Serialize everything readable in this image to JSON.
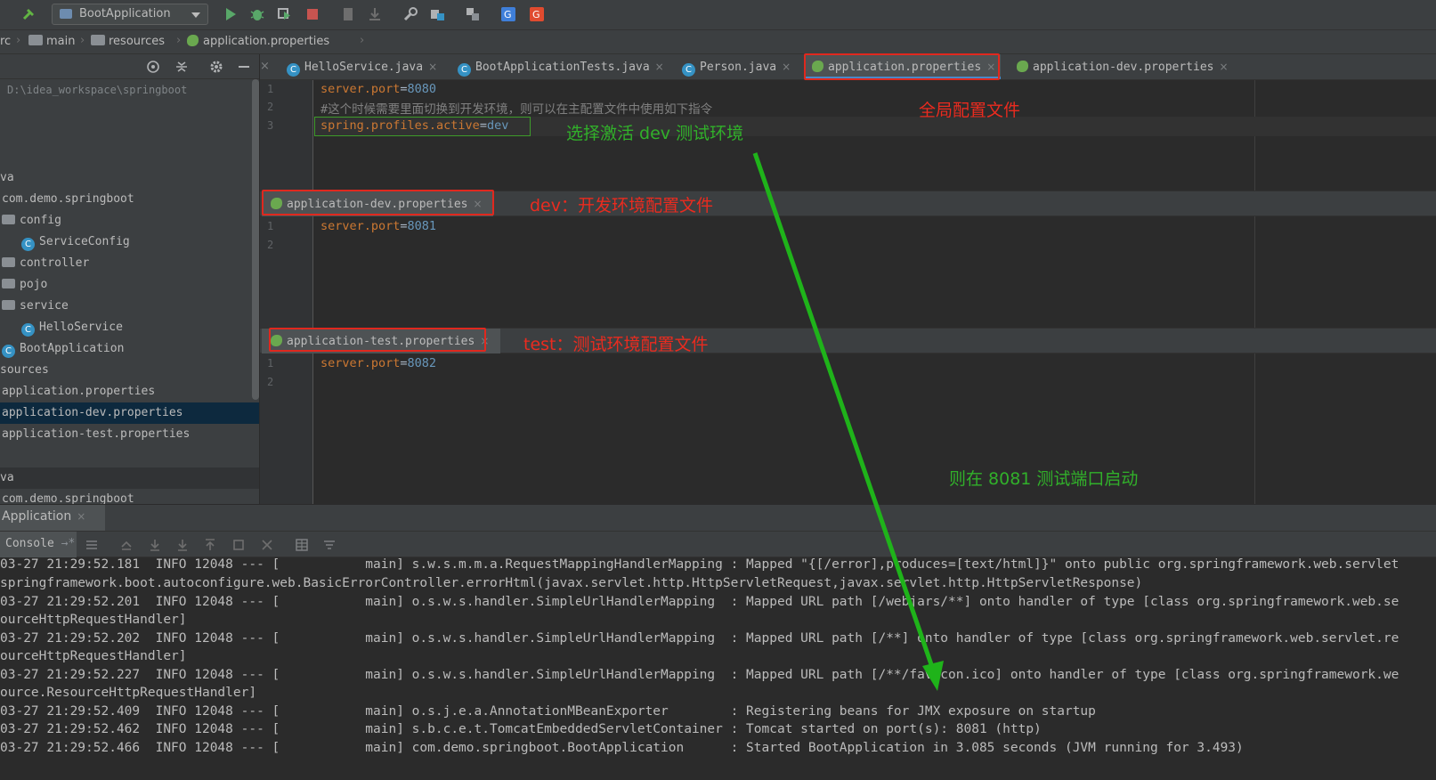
{
  "toolbar": {
    "run_config": "BootApplication",
    "icons": [
      "hammer-icon",
      "run-icon",
      "debug-icon",
      "coverage-icon",
      "stop-icon",
      "bookmark-icon",
      "download-icon",
      "wrench-icon",
      "project-structure-icon",
      "sdk-icon",
      "translate-google-icon",
      "translate-red-icon"
    ]
  },
  "breadcrumb": [
    "rc",
    "main",
    "resources",
    "application.properties"
  ],
  "project": {
    "path": "D:\\idea_workspace\\springboot",
    "items": [
      {
        "label": "va"
      },
      {
        "label": "com.demo.springboot"
      },
      {
        "label": "config"
      },
      {
        "label": "ServiceConfig"
      },
      {
        "label": "controller"
      },
      {
        "label": "pojo"
      },
      {
        "label": "service"
      },
      {
        "label": "HelloService"
      },
      {
        "label": "BootApplication"
      },
      {
        "label": "sources"
      },
      {
        "label": "application.properties"
      },
      {
        "label": "application-dev.properties"
      },
      {
        "label": "application-test.properties"
      },
      {
        "label": "va"
      },
      {
        "label": "com.demo.springboot"
      }
    ]
  },
  "tabs": [
    {
      "label": "HelloService.java"
    },
    {
      "label": "BootApplicationTests.java"
    },
    {
      "label": "Person.java"
    },
    {
      "label": "application.properties"
    },
    {
      "label": "application-dev.properties"
    }
  ],
  "editor_main": {
    "line1": {
      "key": "server.port",
      "value": "8080"
    },
    "line2": "#这个时候需要里面切换到开发环境，则可以在主配置文件中使用如下指令",
    "line3": {
      "key": "spring.profiles.active",
      "value": "dev"
    }
  },
  "editor_dev": {
    "tab": "application-dev.properties",
    "line1": {
      "key": "server.port",
      "value": "8081"
    }
  },
  "editor_test": {
    "tab": "application-test.properties",
    "line1": {
      "key": "server.port",
      "value": "8082"
    }
  },
  "line_numbers": [
    "1",
    "2",
    "3"
  ],
  "annotations": {
    "global": "全局配置文件",
    "activate": "选择激活 dev 测试环境",
    "dev": "dev：开发环境配置文件",
    "test": "test：测试环境配置文件",
    "port": "则在 8081 测试端口启动"
  },
  "colors": {
    "annotation_red": "#ea2b1f",
    "annotation_green": "#31b02a",
    "arrow": "#1fb31a"
  },
  "run": {
    "tab": "Application",
    "console_tab": "Console"
  },
  "console_lines": [
    "03-27 21:29:52.181  INFO 12048 --- [           main] s.w.s.m.m.a.RequestMappingHandlerMapping : Mapped \"{[/error],produces=[text/html]}\" onto public org.springframework.web.servlet",
    "springframework.boot.autoconfigure.web.BasicErrorController.errorHtml(javax.servlet.http.HttpServletRequest,javax.servlet.http.HttpServletResponse)",
    "03-27 21:29:52.201  INFO 12048 --- [           main] o.s.w.s.handler.SimpleUrlHandlerMapping  : Mapped URL path [/webjars/**] onto handler of type [class org.springframework.web.se",
    "ourceHttpRequestHandler]",
    "03-27 21:29:52.202  INFO 12048 --- [           main] o.s.w.s.handler.SimpleUrlHandlerMapping  : Mapped URL path [/**] onto handler of type [class org.springframework.web.servlet.re",
    "ourceHttpRequestHandler]",
    "03-27 21:29:52.227  INFO 12048 --- [           main] o.s.w.s.handler.SimpleUrlHandlerMapping  : Mapped URL path [/**/favicon.ico] onto handler of type [class org.springframework.we",
    "ource.ResourceHttpRequestHandler]",
    "03-27 21:29:52.409  INFO 12048 --- [           main] o.s.j.e.a.AnnotationMBeanExporter        : Registering beans for JMX exposure on startup",
    "03-27 21:29:52.462  INFO 12048 --- [           main] s.b.c.e.t.TomcatEmbeddedServletContainer : Tomcat started on port(s): 8081 (http)",
    "03-27 21:29:52.466  INFO 12048 --- [           main] com.demo.springboot.BootApplication      : Started BootApplication in 3.085 seconds (JVM running for 3.493)"
  ]
}
